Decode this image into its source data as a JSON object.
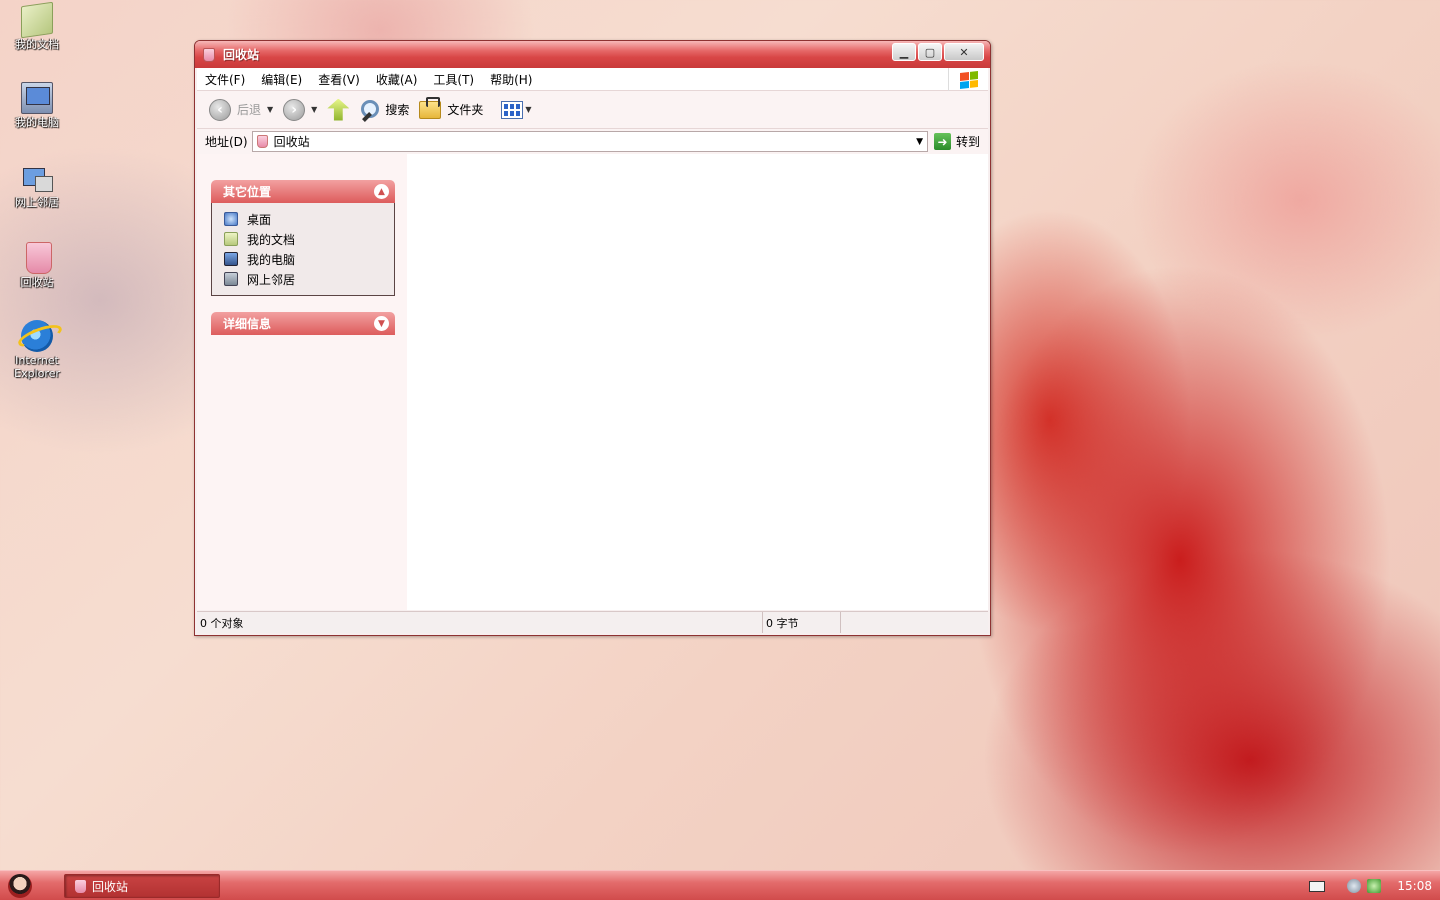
{
  "desktop": {
    "icons": [
      {
        "label": "我的文档"
      },
      {
        "label": "我的电脑"
      },
      {
        "label": "网上邻居"
      },
      {
        "label": "回收站"
      },
      {
        "label": "Internet Explorer"
      }
    ]
  },
  "window": {
    "title": "回收站",
    "menu": [
      "文件(F)",
      "编辑(E)",
      "查看(V)",
      "收藏(A)",
      "工具(T)",
      "帮助(H)"
    ],
    "toolbar": {
      "back_label": "后退",
      "search_label": "搜索",
      "folders_label": "文件夹"
    },
    "address": {
      "label": "地址(D)",
      "value": "回收站",
      "go_label": "转到"
    },
    "taskpane": {
      "other_places": {
        "title": "其它位置",
        "items": [
          "桌面",
          "我的文档",
          "我的电脑",
          "网上邻居"
        ]
      },
      "details": {
        "title": "详细信息"
      }
    },
    "status": {
      "objects": "0 个对象",
      "bytes": "0 字节"
    }
  },
  "taskbar": {
    "task_label": "回收站",
    "clock": "15:08"
  }
}
